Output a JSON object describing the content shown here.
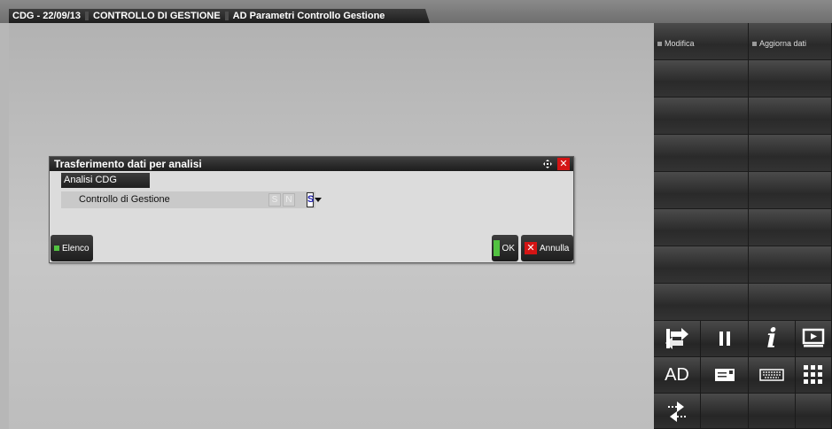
{
  "breadcrumb": {
    "items": [
      "CDG - 22/09/13",
      "CONTROLLO DI GESTIONE",
      "AD Parametri Controllo Gestione"
    ]
  },
  "dialog": {
    "title": "Trasferimento dati per analisi",
    "section_title": "Analisi CDG",
    "field_label": "Controllo di Gestione",
    "option_s": "S",
    "option_n": "N",
    "current_value": "S",
    "elenco_label": "Elenco",
    "ok_label": "OK",
    "annulla_label": "Annulla"
  },
  "right_panel": {
    "modifica_label": "Modifica",
    "aggiorna_label": "Aggiorna dati"
  },
  "icons": {
    "ad_label": "AD"
  }
}
